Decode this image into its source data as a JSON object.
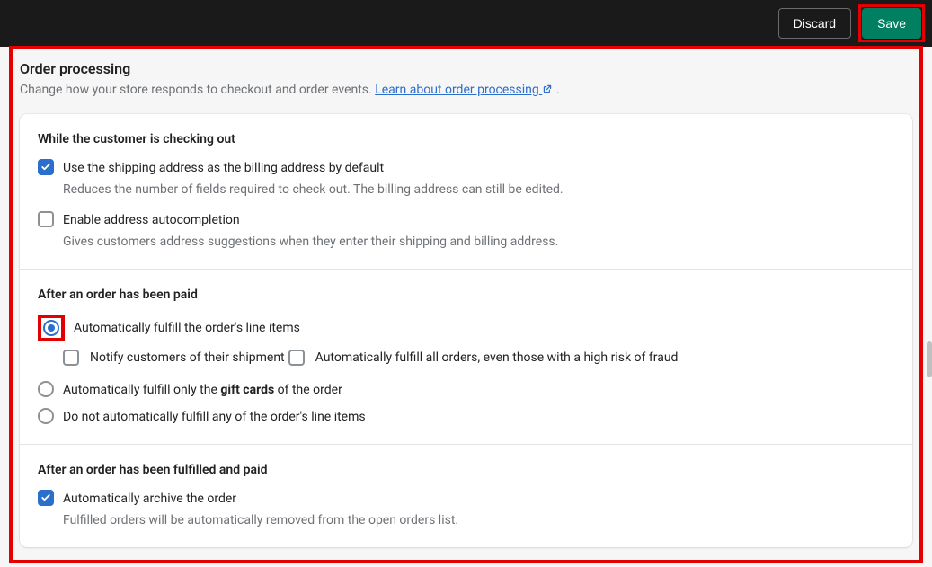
{
  "topbar": {
    "discard_label": "Discard",
    "save_label": "Save"
  },
  "header": {
    "title": "Order processing",
    "description_pre": "Change how your store responds to checkout and order events. ",
    "learn_link_text": "Learn about order processing",
    "description_post": " ."
  },
  "section1": {
    "heading": "While the customer is checking out",
    "opt1_label": "Use the shipping address as the billing address by default",
    "opt1_help": "Reduces the number of fields required to check out. The billing address can still be edited.",
    "opt1_checked": true,
    "opt2_label": "Enable address autocompletion",
    "opt2_help": "Gives customers address suggestions when they enter their shipping and billing address.",
    "opt2_checked": false
  },
  "section2": {
    "heading": "After an order has been paid",
    "r1_label": "Automatically fulfill the order's line items",
    "r1_sub1_label": "Notify customers of their shipment",
    "r1_sub1_checked": false,
    "r1_sub2_label": "Automatically fulfill all orders, even those with a high risk of fraud",
    "r1_sub2_checked": false,
    "r2_pre": "Automatically fulfill only the ",
    "r2_bold": "gift cards",
    "r2_post": " of the order",
    "r3_label": "Do not automatically fulfill any of the order's line items",
    "selected": "r1"
  },
  "section3": {
    "heading": "After an order has been fulfilled and paid",
    "opt1_label": "Automatically archive the order",
    "opt1_help": "Fulfilled orders will be automatically removed from the open orders list.",
    "opt1_checked": true
  }
}
